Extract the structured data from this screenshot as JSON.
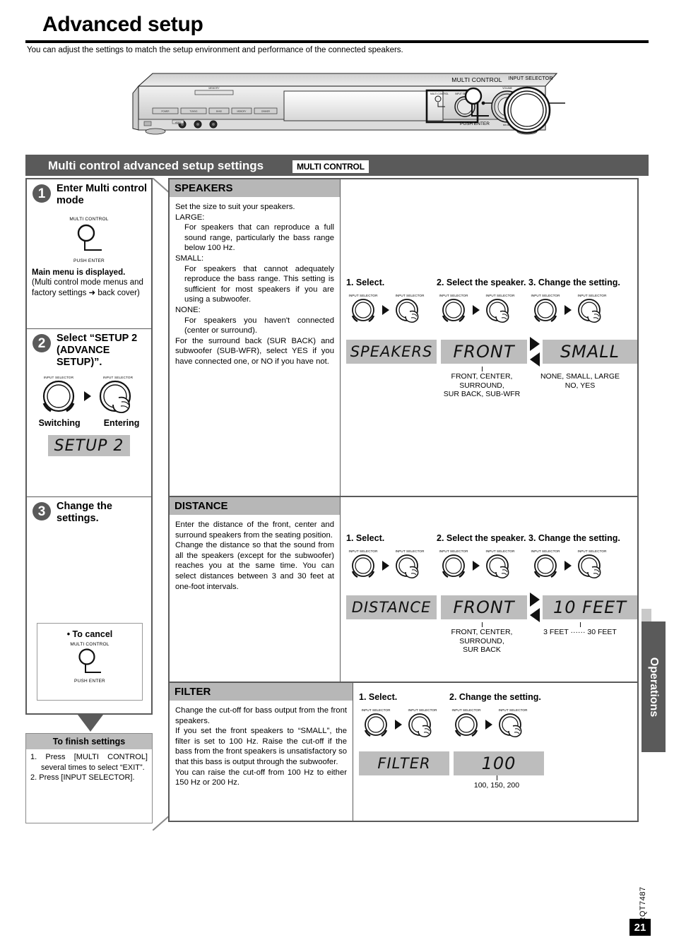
{
  "page": {
    "title": "Advanced setup",
    "intro": "You can adjust the settings to match the setup environment and performance of the connected speakers.",
    "side_tab": "Operations",
    "doc_code": "RQT7487",
    "page_number": "21"
  },
  "device": {
    "callout_multi_control": "MULTI CONTROL",
    "callout_input_selector": "INPUT SELECTOR",
    "callout_push_enter": "PUSH ENTER"
  },
  "band": {
    "title": "Multi control advanced setup settings",
    "chip": "MULTI CONTROL"
  },
  "steps": [
    {
      "number": "1",
      "heading": "Enter Multi control mode",
      "knob_label": "MULTI CONTROL",
      "knob_sub": "PUSH ENTER",
      "note_bold": "Main menu is displayed.",
      "note": "(Multi control mode menus and factory settings ➜ back cover)"
    },
    {
      "number": "2",
      "heading": "Select “SETUP 2 (ADVANCE SETUP)”.",
      "knob_label_left": "INPUT SELECTOR",
      "knob_label_right": "INPUT SELECTOR",
      "action_left": "Switching",
      "action_right": "Entering",
      "display": "SETUP 2"
    },
    {
      "number": "3",
      "heading": "Change the settings.",
      "cancel_title": "• To cancel",
      "cancel_knob_label": "MULTI CONTROL",
      "cancel_knob_sub": "PUSH ENTER"
    }
  ],
  "finish": {
    "heading": "To finish settings",
    "lines": [
      "1. Press [MULTI CONTROL] several times to select “EXIT”.",
      "2. Press [INPUT SELECTOR]."
    ]
  },
  "sections": [
    {
      "name": "SPEAKERS",
      "body": [
        {
          "text": "Set the size to suit your speakers.",
          "indent": false
        },
        {
          "text": "LARGE:",
          "indent": false
        },
        {
          "text": "For speakers that can reproduce a full sound range, particularly the bass range below 100 Hz.",
          "indent": true
        },
        {
          "text": "SMALL:",
          "indent": false
        },
        {
          "text": "For speakers that cannot adequately reproduce the bass range. This setting is sufficient for most speakers if you are using a subwoofer.",
          "indent": true
        },
        {
          "text": "NONE:",
          "indent": false
        },
        {
          "text": "For speakers you haven't connected (center or surround).",
          "indent": true
        },
        {
          "text": "For the surround back (SUR BACK) and subwoofer (SUB-WFR), select YES if you have connected one, or NO if you have not.",
          "indent": false
        }
      ],
      "steps": [
        "1. Select.",
        "2. Select the speaker.",
        "3. Change the setting."
      ],
      "knob_label": "INPUT SELECTOR",
      "displays": [
        {
          "value": "SPEAKERS",
          "caption": ""
        },
        {
          "value": "FRONT",
          "caption": "FRONT, CENTER,\nSURROUND,\nSUR BACK, SUB-WFR"
        },
        {
          "value": "SMALL",
          "caption": "NONE, SMALL, LARGE\nNO, YES"
        }
      ]
    },
    {
      "name": "DISTANCE",
      "body": [
        {
          "text": "Enter the distance of the front, center and surround speakers from the seating position.",
          "indent": false
        },
        {
          "text": "Change the distance so that the sound from all the speakers (except for the subwoofer) reaches you at the same time. You can select distances between 3 and 30 feet at one-foot intervals.",
          "indent": false
        }
      ],
      "steps": [
        "1. Select.",
        "2. Select the speaker.",
        "3. Change the setting."
      ],
      "knob_label": "INPUT SELECTOR",
      "displays": [
        {
          "value": "DISTANCE",
          "caption": ""
        },
        {
          "value": "FRONT",
          "caption": "FRONT, CENTER,\nSURROUND,\nSUR BACK"
        },
        {
          "value": "10 FEET",
          "caption": "3 FEET ······ 30 FEET"
        }
      ]
    },
    {
      "name": "FILTER",
      "body": [
        {
          "text": "Change the cut-off for bass output from the front speakers.",
          "indent": false
        },
        {
          "text": "If you set the front speakers to “SMALL”, the filter is set to 100 Hz. Raise the cut-off if the bass from the front speakers is unsatisfactory so that this bass is output through the subwoofer.",
          "indent": false
        },
        {
          "text": "You can raise the cut-off from 100 Hz to either 150 Hz or 200 Hz.",
          "indent": false
        }
      ],
      "steps": [
        "1. Select.",
        "2. Change the setting."
      ],
      "knob_label": "INPUT SELECTOR",
      "displays": [
        {
          "value": "FILTER",
          "caption": ""
        },
        {
          "value": "100",
          "caption": "100, 150, 200"
        }
      ]
    }
  ]
}
